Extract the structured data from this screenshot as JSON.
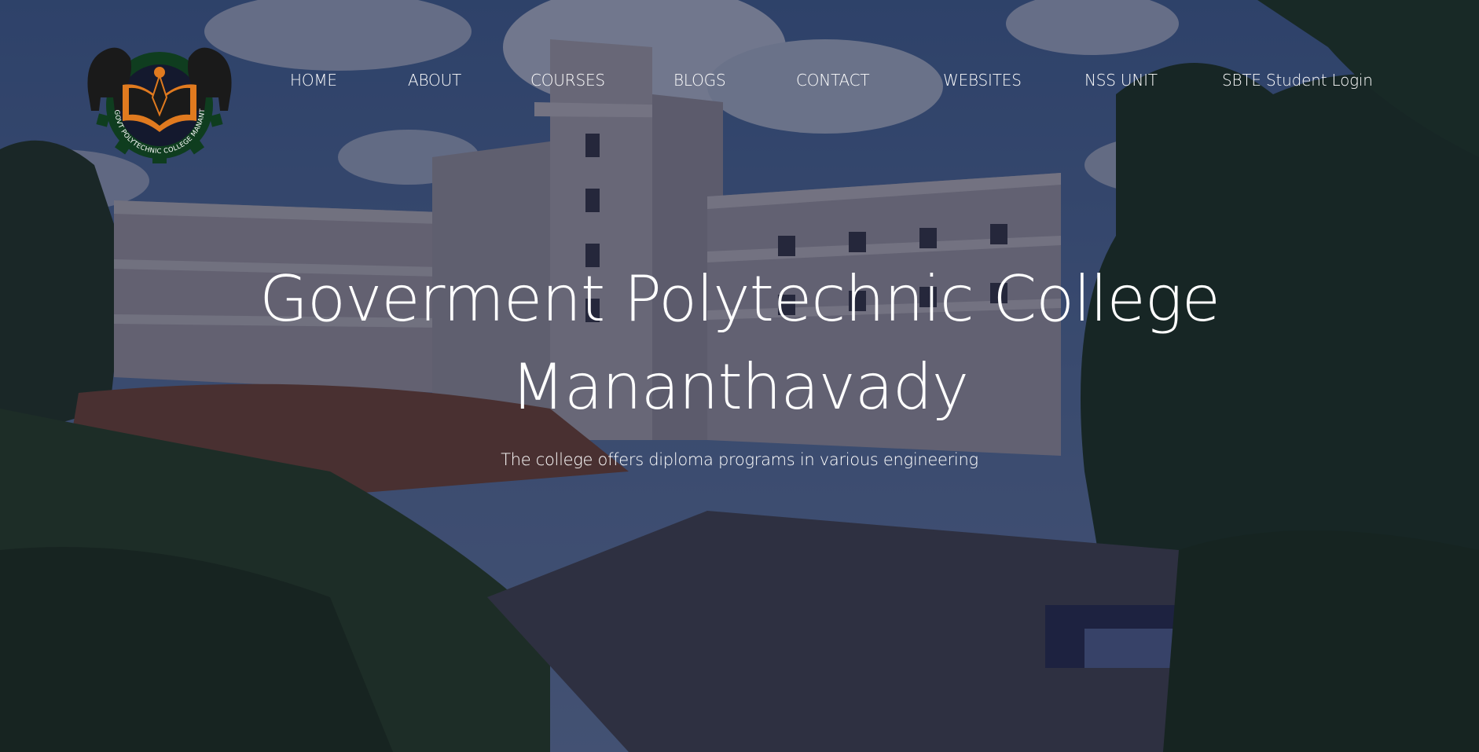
{
  "nav": {
    "items": [
      {
        "label": "HOME"
      },
      {
        "label": "ABOUT"
      },
      {
        "label": "COURSES"
      },
      {
        "label": "BLOGS"
      },
      {
        "label": "CONTACT"
      },
      {
        "label": "WEBSITES"
      },
      {
        "label": "NSS UNIT"
      },
      {
        "label": "SBTE Student Login"
      }
    ]
  },
  "logo": {
    "text": "GOVT POLYTECHNIC COLLEGE MANANTHAVADY",
    "colors": {
      "gear": "#0f3d1f",
      "book": "#e07a1f",
      "elephant": "#1a1a1a"
    }
  },
  "hero": {
    "title_line1": "Goverment Polytechnic College",
    "title_line2": "Mananthavady",
    "subtitle": "The college offers diploma programs in various engineering"
  },
  "colors": {
    "overlay": "#0e122d",
    "text": "#ffffff"
  }
}
